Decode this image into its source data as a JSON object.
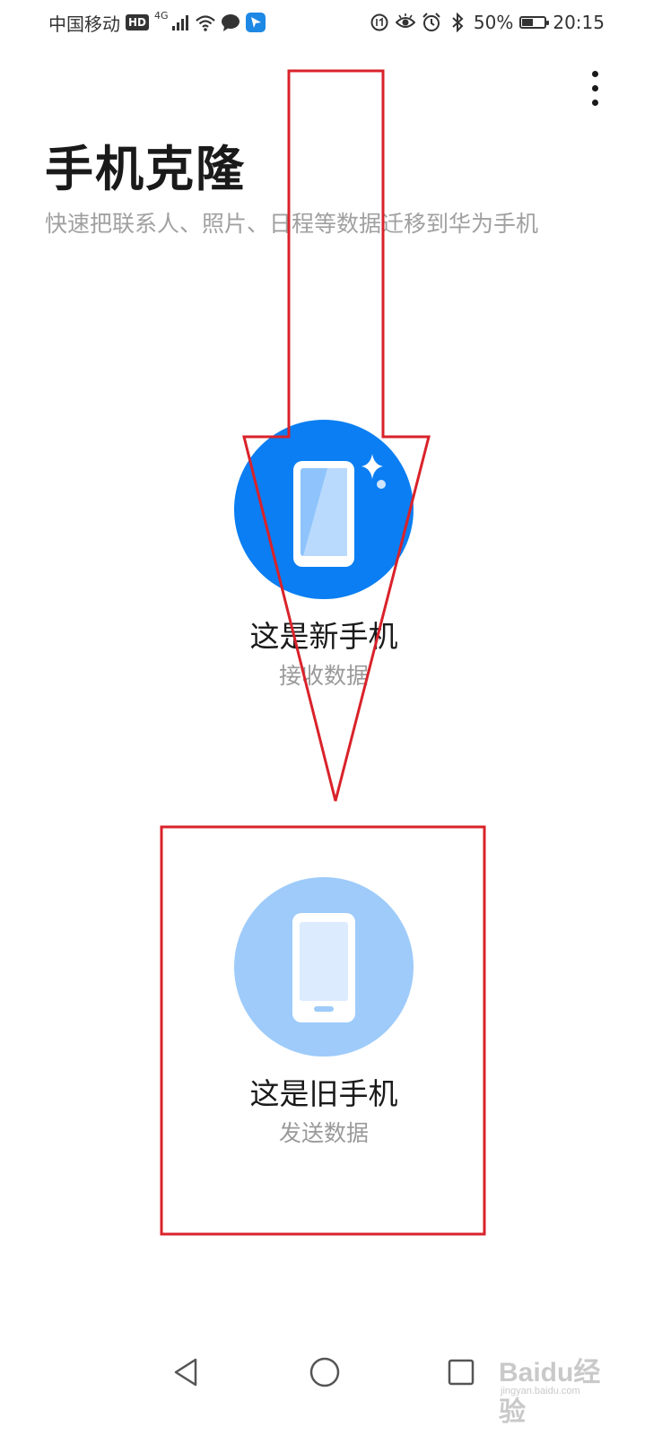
{
  "status_bar": {
    "carrier": "中国移动",
    "hd": "HD",
    "network": "4G",
    "battery_percent": "50%",
    "battery_level": 0.5,
    "time": "20:15"
  },
  "header": {
    "title": "手机克隆",
    "subtitle": "快速把联系人、照片、日程等数据迁移到华为手机"
  },
  "options": [
    {
      "title": "这是新手机",
      "subtitle": "接收数据"
    },
    {
      "title": "这是旧手机",
      "subtitle": "发送数据"
    }
  ],
  "colors": {
    "primary_blue": "#0a7ef2",
    "light_blue": "#9ecbfa",
    "annotation_red": "#d9222a"
  },
  "watermark": {
    "brand": "Baidu经验",
    "url": "jingyan.baidu.com"
  }
}
